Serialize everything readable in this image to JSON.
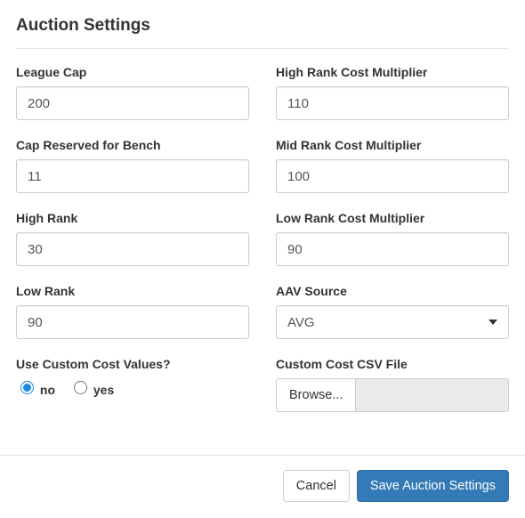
{
  "title": "Auction Settings",
  "left": {
    "league_cap": {
      "label": "League Cap",
      "value": "200"
    },
    "cap_reserved": {
      "label": "Cap Reserved for Bench",
      "value": "11"
    },
    "high_rank": {
      "label": "High Rank",
      "value": "30"
    },
    "low_rank": {
      "label": "Low Rank",
      "value": "90"
    },
    "use_custom": {
      "label": "Use Custom Cost Values?",
      "no_label": "no",
      "yes_label": "yes",
      "selected": "no"
    }
  },
  "right": {
    "high_mult": {
      "label": "High Rank Cost Multiplier",
      "value": "110"
    },
    "mid_mult": {
      "label": "Mid Rank Cost Multiplier",
      "value": "100"
    },
    "low_mult": {
      "label": "Low Rank Cost Multiplier",
      "value": "90"
    },
    "aav_source": {
      "label": "AAV Source",
      "value": "AVG"
    },
    "csv": {
      "label": "Custom Cost CSV File",
      "button": "Browse..."
    }
  },
  "footer": {
    "cancel": "Cancel",
    "save": "Save Auction Settings"
  }
}
